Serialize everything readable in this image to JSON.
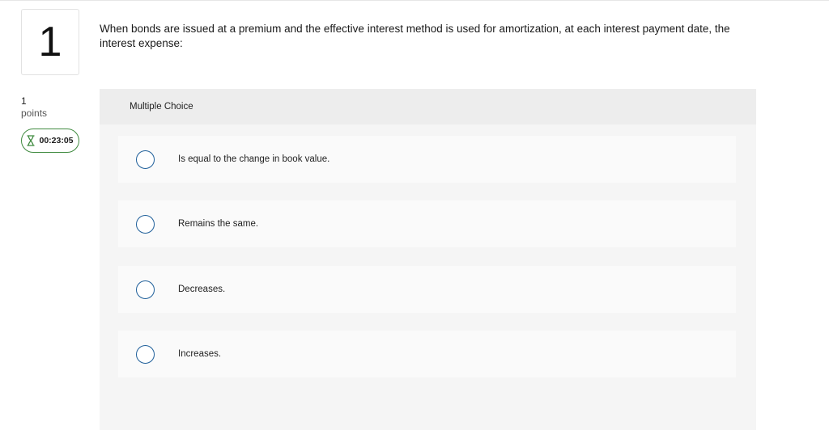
{
  "question": {
    "number": "1",
    "points_value": "1",
    "points_label": "points",
    "timer": "00:23:05",
    "text": "When bonds are issued at a premium and the effective interest method is used for amortization, at each interest payment date, the interest expense:"
  },
  "multiple_choice": {
    "header": "Multiple Choice",
    "options": [
      {
        "label": "Is equal to the change in book value."
      },
      {
        "label": "Remains the same."
      },
      {
        "label": "Decreases."
      },
      {
        "label": "Increases."
      }
    ]
  },
  "colors": {
    "radio_border": "#1f5f9a",
    "timer_border": "#3f8a3f",
    "panel_bg": "#f5f5f5",
    "header_bg": "#ededed"
  },
  "icons": {
    "timer": "hourglass-icon"
  }
}
